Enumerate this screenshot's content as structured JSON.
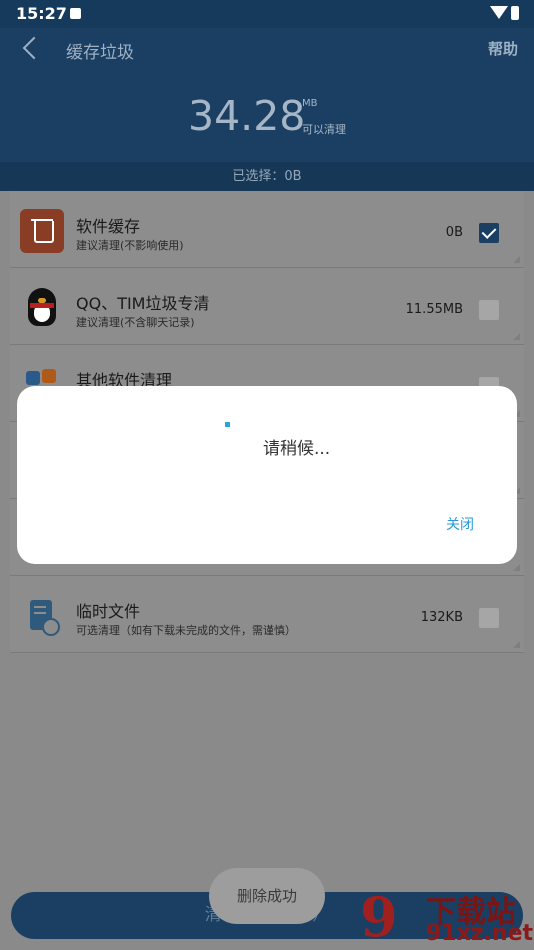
{
  "status_bar": {
    "time": "15:27"
  },
  "header": {
    "title": "缓存垃圾",
    "help": "帮助",
    "size": "34.28",
    "unit": "MB",
    "cleanable": "可以清理"
  },
  "selected_bar": "已选择：0B",
  "items": [
    {
      "name": "软件缓存",
      "desc": "建议清理(不影响使用)",
      "size": "0B",
      "checked": true,
      "icon": "trash-icon"
    },
    {
      "name": "QQ、TIM垃圾专清",
      "desc": "建议清理(不含聊天记录)",
      "size": "11.55MB",
      "checked": false,
      "icon": "qq-penguin-icon"
    },
    {
      "name": "其他软件清理",
      "desc": "",
      "size": "",
      "checked": false,
      "icon": "apps-icon"
    },
    {
      "name": "",
      "desc": "",
      "size": "",
      "checked": false,
      "icon": ""
    },
    {
      "name": "",
      "desc": "",
      "size": "",
      "checked": false,
      "icon": ""
    },
    {
      "name": "临时文件",
      "desc": "可选清理（如有下载未完成的文件，需谨慎）",
      "size": "132KB",
      "checked": false,
      "icon": "document-clock-icon"
    }
  ],
  "clean_button": "清理（已选0B）",
  "toast": "删除成功",
  "dialog": {
    "message": "请稍候...",
    "close": "关闭"
  },
  "watermark": {
    "mark": "9",
    "brand": "下载站",
    "url": "91xz.net"
  },
  "colors": {
    "header": "#1a3f62",
    "accent": "#2a9ad6",
    "dialog_bg": "#ffffff"
  }
}
